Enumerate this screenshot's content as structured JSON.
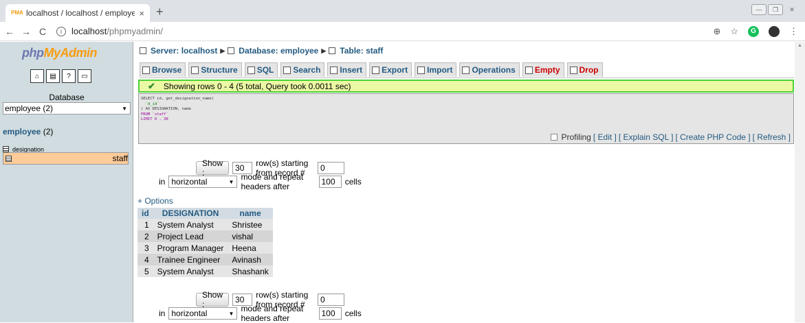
{
  "browser": {
    "tab_title": "localhost / localhost / employee",
    "tab_close": "×",
    "new_tab": "+",
    "favicon": "PMA",
    "url_host": "localhost",
    "url_path": "/phpmyadmin/"
  },
  "sidebar": {
    "logo_php": "php",
    "logo_my": "My",
    "logo_admin": "Admin",
    "database_label": "Database",
    "database_select": "employee (2)",
    "db_name": "employee",
    "db_count": "(2)",
    "tables": [
      "designation",
      "staff"
    ]
  },
  "breadcrumb": {
    "server": "Server: localhost",
    "database": "Database: employee",
    "table": "Table: staff"
  },
  "tabs": {
    "browse": "Browse",
    "structure": "Structure",
    "sql": "SQL",
    "search": "Search",
    "insert": "Insert",
    "export": "Export",
    "import": "Import",
    "operations": "Operations",
    "empty": "Empty",
    "drop": "Drop"
  },
  "result": {
    "message": "Showing rows 0 - 4 (5 total, Query took 0.0011 sec)"
  },
  "sql": {
    "line1": "SELECT id, get_designation_name(",
    "line2": "  `d_id`",
    "line3": ") AS DESIGNATION, name",
    "line4": "FROM `staff`",
    "line5": "LIMIT 0 , 30"
  },
  "sql_links": {
    "profiling": "Profiling",
    "edit": "[ Edit ]",
    "explain": "[ Explain SQL ]",
    "create_php": "[ Create PHP Code ]",
    "refresh": "[ Refresh ]"
  },
  "nav": {
    "show_button": "Show :",
    "rows_value": "30",
    "rows_text": "row(s) starting from record #",
    "start_value": "0",
    "in_text": "in",
    "mode_value": "horizontal",
    "mode_text": "mode and repeat headers after",
    "repeat_value": "100",
    "cells_text": "cells"
  },
  "options_link": "+ Options",
  "table": {
    "headers": [
      "id",
      "DESIGNATION",
      "name"
    ],
    "rows": [
      [
        "1",
        "System Analyst",
        "Shristee"
      ],
      [
        "2",
        "Project Lead",
        "vishal"
      ],
      [
        "3",
        "Program Manager",
        "Heena"
      ],
      [
        "4",
        "Trainee Engineer",
        "Avinash"
      ],
      [
        "5",
        "System Analyst",
        "Shashank"
      ]
    ]
  }
}
